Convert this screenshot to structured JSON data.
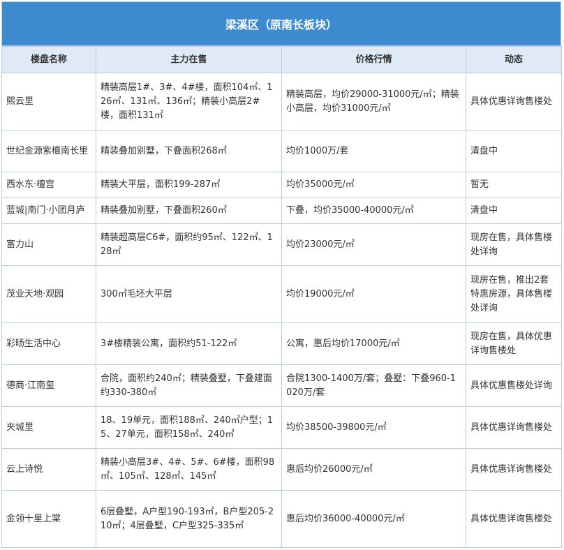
{
  "title": "梁溪区（原南长板块）",
  "headers": [
    "楼盘名称",
    "主力在售",
    "价格行情",
    "动态"
  ],
  "rows": [
    {
      "name": "熙云里",
      "sale": "精装高层1#、3#、4#楼，面积104㎡、126㎡、131㎡、136㎡；精装小高层2#楼，面积131㎡",
      "price": "精装高层，均价29000-31000元/㎡；精装小高层，均价31000元/㎡",
      "status": "具体优惠详询售楼处"
    },
    {
      "name": "世纪金源紫檀南长里",
      "sale": "精装叠加别墅，下叠面积268㎡",
      "price": "均价1000万/套",
      "status": "清盘中"
    },
    {
      "name": "西水东·檀宫",
      "sale": "精装大平层，面积199-287㎡",
      "price": "均价35000元/㎡",
      "status": "暂无"
    },
    {
      "name": "蓝城|南门·小团月庐",
      "sale": "精装叠加别墅，下叠面积260㎡",
      "price": "下叠，均价35000-40000元/㎡",
      "status": "清盘中"
    },
    {
      "name": "富力山",
      "sale": "精装超高层C6#，面积约95㎡、122㎡、128㎡",
      "price": "均价23000元/㎡",
      "status": "现房在售，具体售楼处详询"
    },
    {
      "name": "茂业天地·观园",
      "sale": "300㎡毛坯大平层",
      "price": "均价19000元/㎡",
      "status": "现房在售，推出2套特惠房源，具体售楼处详询"
    },
    {
      "name": "彩旸生活中心",
      "sale": "3#楼精装公寓，面积约51-122㎡",
      "price": "公寓，惠后均价17000元/㎡",
      "status": "现房在售，具体优惠详询售楼处"
    },
    {
      "name": "德商·江南玺",
      "sale": "合院，面积约240㎡；精装叠墅，下叠建面约330-380㎡",
      "price": "合院1300-1400万/套；叠墅：下叠960-1020万/套",
      "status": "具体优惠售楼处详询"
    },
    {
      "name": "夹城里",
      "sale": "18、19单元，面积188㎡、240㎡户型；15、27单元，面积158㎡、240㎡",
      "price": "均价38500-39800元/㎡",
      "status": "具体优惠详询售楼处"
    },
    {
      "name": "云上诗悦",
      "sale": "精装小高层3#、4#、5#、6#楼，面积98㎡、105㎡、128㎡、145㎡",
      "price": "惠后均价26000元/㎡",
      "status": "具体优惠详询售楼处"
    },
    {
      "name": "金领十里上棠",
      "sale": "6层叠墅，A户型190-193㎡，B户型205-210㎡；4层叠墅，C户型325-335㎡",
      "price": "惠后均价36000-40000元/㎡",
      "status": "具体优惠详询售楼处"
    }
  ]
}
